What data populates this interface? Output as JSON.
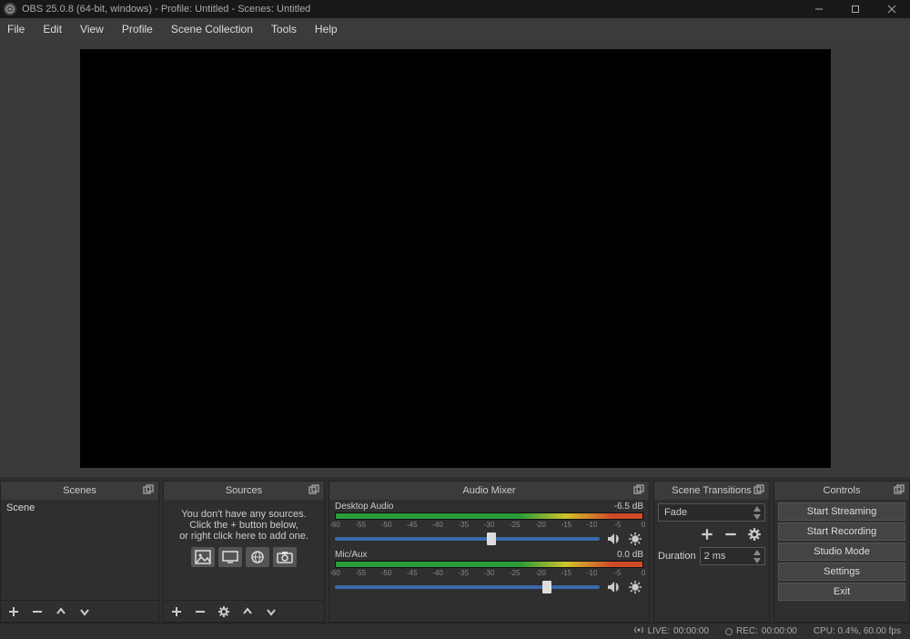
{
  "title": "OBS 25.0.8 (64-bit, windows) - Profile: Untitled - Scenes: Untitled",
  "menu": [
    "File",
    "Edit",
    "View",
    "Profile",
    "Scene Collection",
    "Tools",
    "Help"
  ],
  "docks": {
    "scenes": {
      "title": "Scenes"
    },
    "sources": {
      "title": "Sources"
    },
    "mixer": {
      "title": "Audio Mixer"
    },
    "transitions": {
      "title": "Scene Transitions"
    },
    "controls": {
      "title": "Controls"
    }
  },
  "scenes": {
    "items": [
      "Scene"
    ]
  },
  "sources_empty": {
    "line1": "You don't have any sources.",
    "line2": "Click the + button below,",
    "line3": "or right click here to add one."
  },
  "mixer": {
    "ticks": [
      "-60",
      "-55",
      "-50",
      "-45",
      "-40",
      "-35",
      "-30",
      "-25",
      "-20",
      "-15",
      "-10",
      "-5",
      "0"
    ],
    "channels": [
      {
        "name": "Desktop Audio",
        "level": "-6.5 dB",
        "thumb_pct": 59
      },
      {
        "name": "Mic/Aux",
        "level": "0.0 dB",
        "thumb_pct": 80
      }
    ]
  },
  "transitions": {
    "selected": "Fade",
    "duration_label": "Duration",
    "duration_value": "2 ms"
  },
  "controls": {
    "buttons": [
      "Start Streaming",
      "Start Recording",
      "Studio Mode",
      "Settings",
      "Exit"
    ]
  },
  "status": {
    "live_label": "LIVE:",
    "live_time": "00:00:00",
    "rec_label": "REC:",
    "rec_time": "00:00:00",
    "cpu": "CPU: 0.4%, 60.00 fps"
  }
}
